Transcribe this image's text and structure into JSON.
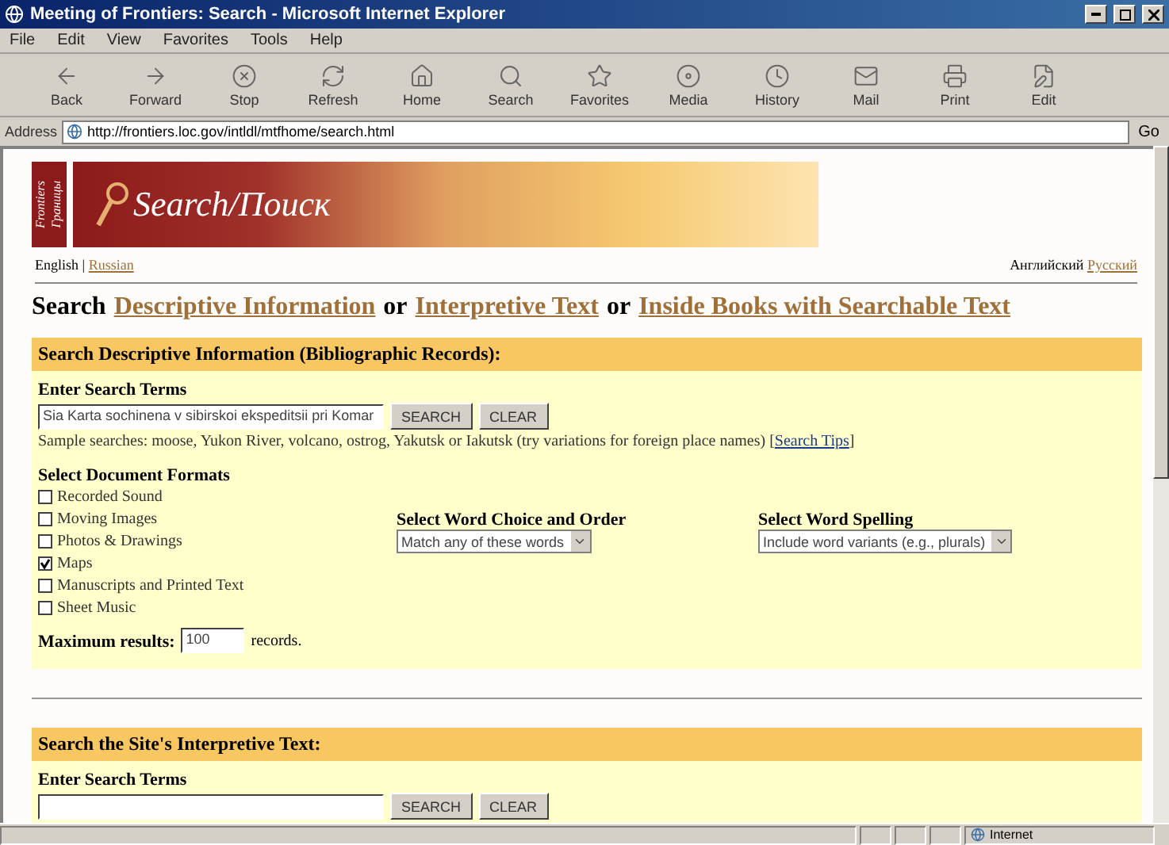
{
  "window": {
    "title": "Meeting of Frontiers: Search - Microsoft Internet Explorer"
  },
  "menu": [
    "File",
    "Edit",
    "View",
    "Favorites",
    "Tools",
    "Help"
  ],
  "toolbar": [
    {
      "label": "Back",
      "kind": "back"
    },
    {
      "label": "Forward",
      "kind": "forward"
    },
    {
      "label": "Stop",
      "kind": "stop"
    },
    {
      "label": "Refresh",
      "kind": "refresh"
    },
    {
      "label": "Home",
      "kind": "home"
    },
    {
      "label": "Search",
      "kind": "search"
    },
    {
      "label": "Favorites",
      "kind": "favorites"
    },
    {
      "label": "Media",
      "kind": "media"
    },
    {
      "label": "History",
      "kind": "history"
    },
    {
      "label": "Mail",
      "kind": "mail"
    },
    {
      "label": "Print",
      "kind": "print"
    },
    {
      "label": "Edit",
      "kind": "edit"
    }
  ],
  "address": {
    "label": "Address",
    "value": "http://frontiers.loc.gov/intldl/mtfhome/search.html",
    "go": "Go"
  },
  "banner": {
    "logo_top": "Frontiers",
    "logo_bottom": "Границы",
    "title": "Search/Поиск"
  },
  "language": {
    "left": "English",
    "separator": "|",
    "left_link": "Russian",
    "right": "Английский",
    "right_link": "Русский"
  },
  "heading": {
    "prefix": "Search",
    "links": [
      "Descriptive Information",
      "Interpretive Text",
      "Inside Books with Searchable Text"
    ],
    "joiners": [
      "or",
      "or"
    ]
  },
  "descriptive": {
    "title": "Search Descriptive Information (Bibliographic Records):",
    "terms_label": "Enter Search Terms",
    "query": "Sia Karta sochinena v sibirskoi ekspeditsii pri Komar",
    "search_button": "SEARCH",
    "clear_button": "CLEAR",
    "samples": "Sample searches: moose, Yukon River, volcano, ostrog, Yakutsk or Iakutsk (try variations for foreign place names)  [",
    "tips_link": "Search Tips",
    "tips_close": "]",
    "formats_label": "Select Document Formats",
    "formats": [
      {
        "label": "Recorded Sound",
        "checked": false
      },
      {
        "label": "Moving Images",
        "checked": false
      },
      {
        "label": "Photos & Drawings",
        "checked": false
      },
      {
        "label": "Maps",
        "checked": true
      },
      {
        "label": "Manuscripts and Printed Text",
        "checked": false
      },
      {
        "label": "Sheet Music",
        "checked": false
      }
    ],
    "word_choice_label": "Select Word Choice and Order",
    "word_choice": "Match any of these words",
    "spelling_label": "Select Word Spelling",
    "spelling": "Include word variants (e.g., plurals)",
    "max_label": "Maximum results:",
    "max_value": "100",
    "max_unit": "records."
  },
  "interpretive": {
    "title": "Search the Site's Interpretive Text:",
    "terms_label": "Enter Search Terms",
    "search_button": "SEARCH",
    "clear_button": "CLEAR"
  },
  "status_bar": {
    "zone": "Internet"
  }
}
